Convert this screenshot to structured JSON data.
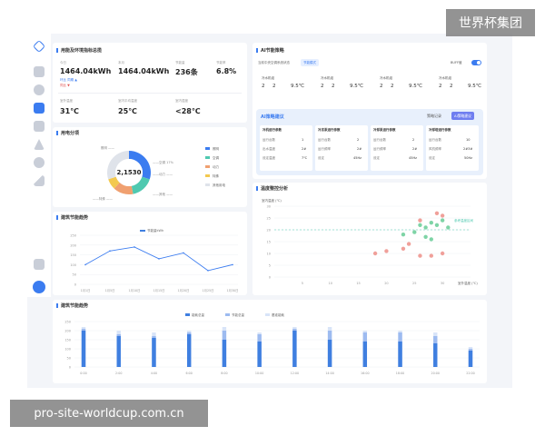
{
  "watermarks": {
    "top_right": "世界杯集团",
    "bottom_left": "pro-site-worldcup.com.cn"
  },
  "colors": {
    "accent": "#3b7cf0",
    "teal": "#4fc9b0",
    "orange": "#f0a070",
    "yellow": "#f3c94f",
    "green_pt": "#7ed4a6",
    "red_pt": "#f0a09a",
    "bar_dark": "#3f7fe0",
    "bar_light": "#b9cff4"
  },
  "sidebar": {
    "icons": [
      "cube-icon",
      "monitor-icon",
      "dashboard-icon",
      "layers-icon",
      "warning-icon",
      "settings-icon",
      "trend-icon",
      "document-icon",
      "user-avatar-icon"
    ]
  },
  "energy_overview": {
    "title": "用能及环境指标总揽",
    "metrics": [
      {
        "label": "今日",
        "value": "1464.04kWh",
        "sub1": "环比 同期 ▲",
        "sub2": "同比 ▼"
      },
      {
        "label": "本月",
        "value": "1464.04kWh"
      },
      {
        "label": "节能量",
        "value": "236条"
      },
      {
        "label": "节能率",
        "value": "6.8%"
      }
    ],
    "env": [
      {
        "label": "室外温度",
        "value": "31℃"
      },
      {
        "label": "室内平均温度",
        "value": "25℃"
      },
      {
        "label": "室内湿度",
        "value": "<28℃"
      }
    ]
  },
  "ai_strategy": {
    "title": "AI节能策略",
    "subtitle": "当前中央空调系统状态",
    "badge": "节能模式",
    "toggle_label": "BUFF值",
    "groups": [
      {
        "name": "冷水机组",
        "vals": [
          "2",
          "2",
          "9.5℃"
        ]
      },
      {
        "name": "冷水机组",
        "vals": [
          "2",
          "2",
          "9.5℃"
        ]
      },
      {
        "name": "冷水机组",
        "vals": [
          "2",
          "2",
          "9.5℃"
        ]
      },
      {
        "name": "冷水机组",
        "vals": [
          "2",
          "2",
          "9.5℃"
        ]
      }
    ]
  },
  "ai_advice": {
    "title": "AI策略建议",
    "history_btn": "策略记录",
    "action_btn": "AI策略建议",
    "cols": [
      {
        "title": "冷机运行参数",
        "rows": [
          [
            "运行台数",
            "1"
          ],
          [
            "出水温度",
            "2#"
          ],
          [
            "设定温度",
            "7℃"
          ]
        ]
      },
      {
        "title": "冷冻泵运行参数",
        "rows": [
          [
            "运行台数",
            "2"
          ],
          [
            "运行频率",
            "2#"
          ],
          [
            "设定",
            "45Hz"
          ]
        ]
      },
      {
        "title": "冷却泵运行参数",
        "rows": [
          [
            "运行台数",
            "2"
          ],
          [
            "运行频率",
            "2#"
          ],
          [
            "设定",
            "45Hz"
          ]
        ]
      },
      {
        "title": "冷却塔运行参数",
        "rows": [
          [
            "运行台数",
            "10"
          ],
          [
            "风机频率",
            "2#3#"
          ],
          [
            "设定",
            "50Hz"
          ]
        ]
      }
    ]
  },
  "donut": {
    "title": "用电分项",
    "center": "2,1530",
    "callouts": [
      "照明 ——",
      "——空调 17%",
      "——动力 ——",
      "——其他 ——",
      "——特殊 ——"
    ],
    "legend": [
      "照明",
      "空调",
      "动力",
      "特殊",
      "其他用电"
    ]
  },
  "trend": {
    "title": "建筑节能趋势",
    "legend": "节能量kWh",
    "ylabels": [
      "250",
      "200",
      "150",
      "100",
      "50",
      "0"
    ],
    "xlabels": [
      "1月1日",
      "1月5日",
      "1月10日",
      "1月15日",
      "1月20日",
      "1月25日",
      "1月30日"
    ]
  },
  "scatter": {
    "title": "温度整控分析",
    "ytitle": "室内温度 (℃)",
    "xtitle": "室外温度 (℃)",
    "yticks": [
      "30",
      "25",
      "20",
      "15",
      "10",
      "5",
      "0"
    ],
    "xticks": [
      "5",
      "10",
      "15",
      "20",
      "25",
      "30"
    ],
    "ref_label": "参考温度区间"
  },
  "bottom_bars": {
    "title": "建筑节能趋势",
    "legend": [
      "能耗总量",
      "节能总量",
      "基准能耗"
    ],
    "ylabels": [
      "250",
      "200",
      "150",
      "100",
      "50",
      "0"
    ],
    "xlabels": [
      "0:00",
      "2:00",
      "4:00",
      "6:00",
      "8:00",
      "10:00",
      "12:00",
      "14:00",
      "16:00",
      "18:00",
      "20:00",
      "22:00"
    ]
  },
  "chart_data": [
    {
      "type": "pie",
      "title": "用电分项",
      "labels": [
        "照明",
        "空调",
        "动力",
        "特殊",
        "其他用电"
      ],
      "values": [
        30,
        17,
        15,
        8,
        30
      ]
    },
    {
      "type": "line",
      "title": "建筑节能趋势",
      "x": [
        "1月1日",
        "1月5日",
        "1月10日",
        "1月15日",
        "1月20日",
        "1月25日",
        "1月30日"
      ],
      "series": [
        {
          "name": "节能量kWh",
          "values": [
            100,
            170,
            190,
            130,
            160,
            70,
            100
          ]
        }
      ],
      "ylim": [
        0,
        250
      ]
    },
    {
      "type": "scatter",
      "title": "温度整控分析",
      "xlabel": "室外温度 (℃)",
      "ylabel": "室内温度 (℃)",
      "xlim": [
        0,
        35
      ],
      "ylim": [
        0,
        30
      ],
      "series": [
        {
          "color": "green",
          "points": [
            [
              23,
              18
            ],
            [
              25,
              19
            ],
            [
              26,
              22
            ],
            [
              27,
              21
            ],
            [
              28,
              23
            ],
            [
              29,
              22
            ],
            [
              30,
              24
            ],
            [
              31,
              21
            ],
            [
              27,
              17
            ],
            [
              28,
              16
            ]
          ]
        },
        {
          "color": "red",
          "points": [
            [
              18,
              10
            ],
            [
              20,
              11
            ],
            [
              23,
              12
            ],
            [
              24,
              14
            ],
            [
              26,
              9
            ],
            [
              28,
              9
            ],
            [
              30,
              10
            ],
            [
              30,
              26
            ],
            [
              29,
              27
            ],
            [
              26,
              24
            ]
          ]
        }
      ]
    },
    {
      "type": "bar",
      "title": "建筑节能趋势",
      "categories": [
        "0:00",
        "2:00",
        "4:00",
        "6:00",
        "8:00",
        "10:00",
        "12:00",
        "14:00",
        "16:00",
        "18:00",
        "20:00",
        "22:00"
      ],
      "series": [
        {
          "name": "能耗总量",
          "values": [
            200,
            170,
            160,
            180,
            150,
            140,
            200,
            150,
            140,
            140,
            130,
            90
          ]
        },
        {
          "name": "节能总量",
          "values": [
            210,
            180,
            170,
            190,
            200,
            180,
            210,
            200,
            190,
            190,
            170,
            100
          ]
        },
        {
          "name": "基准能耗",
          "values": [
            220,
            200,
            190,
            200,
            220,
            190,
            220,
            220,
            200,
            200,
            190,
            110
          ]
        }
      ],
      "ylim": [
        0,
        250
      ]
    }
  ]
}
